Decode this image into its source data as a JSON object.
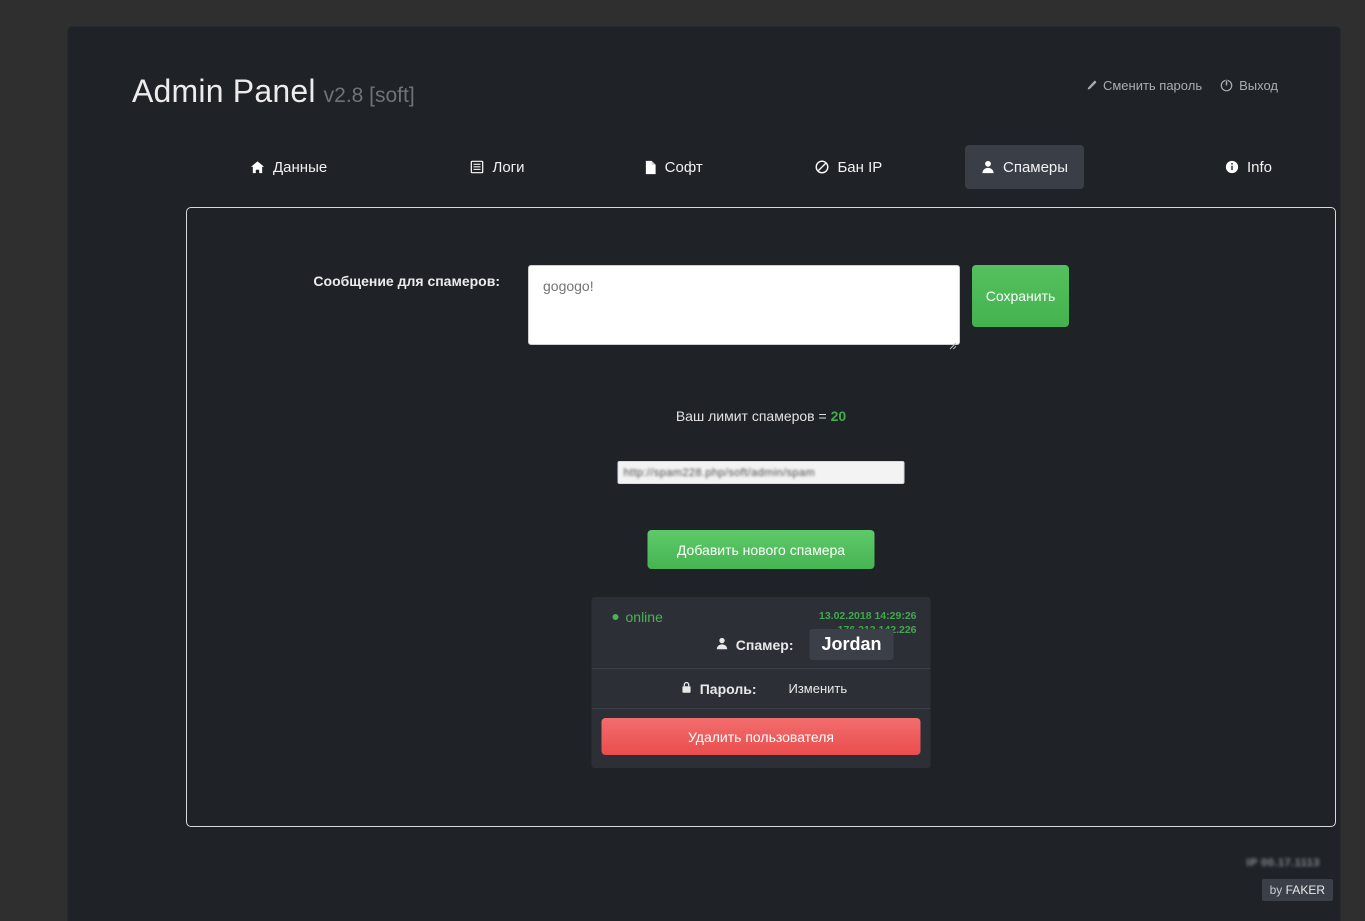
{
  "brand": {
    "name": "Admin Panel",
    "version": "v2.8 [soft]"
  },
  "header_links": [
    {
      "label": "Сменить пароль",
      "icon": "pencil-icon"
    },
    {
      "label": "Выход",
      "icon": "power-icon"
    }
  ],
  "tabs": [
    {
      "label": "Данные",
      "icon": "home-icon",
      "active": false
    },
    {
      "label": "Логи",
      "icon": "list-icon",
      "active": false
    },
    {
      "label": "Софт",
      "icon": "file-icon",
      "active": false
    },
    {
      "label": "Бан IP",
      "icon": "ban-icon",
      "active": false
    },
    {
      "label": "Спамеры",
      "icon": "user-icon",
      "active": true
    },
    {
      "label": "Info",
      "icon": "info-icon",
      "active": false
    }
  ],
  "main": {
    "message_label": "Сообщение для спамеров:",
    "message_placeholder": "gogogo!",
    "message_value": "",
    "save_label": "Сохранить",
    "limit_text": "Ваш лимит спамеров = ",
    "limit_value": "20",
    "url_value": "http://spam228.php/soft/admin/spam",
    "add_spammer_label": "Добавить нового спамера"
  },
  "spammer_card": {
    "status": "online",
    "last_seen": "13.02.2018 14:29:26",
    "ip": "176.213.142.226",
    "spammer_label": "Спамер:",
    "spammer_name": "Jordan",
    "password_label": "Пароль:",
    "password_action": "Изменить",
    "delete_label": "Удалить пользователя"
  },
  "footer": {
    "blurred_text": "IP 00.17.1113",
    "badge_by": "by",
    "badge_name": "FAKER"
  },
  "colors": {
    "page_bg": "#2f2f2f",
    "window_bg": "#1f2227",
    "accent_green": "#49b356",
    "danger_red": "#ea4d4d",
    "tab_active_bg": "#3a3f47",
    "card_bg": "#2c3036"
  }
}
